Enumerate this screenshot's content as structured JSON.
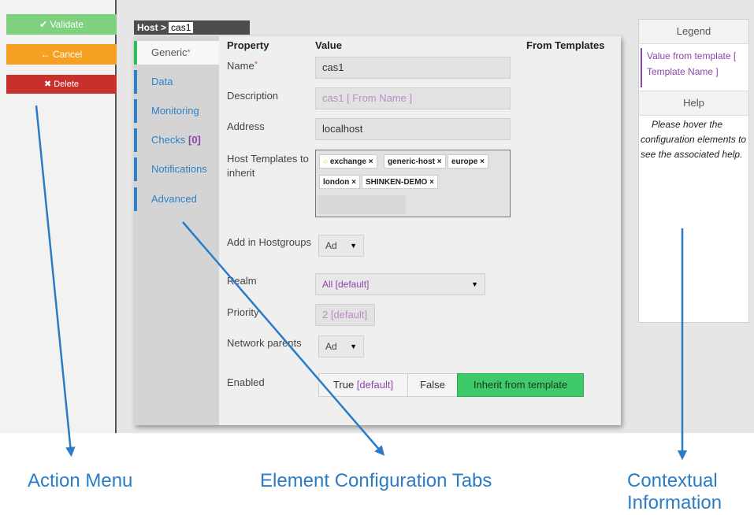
{
  "actions": {
    "validate": "✔ Validate",
    "cancel": "← Cancel",
    "delete": "✖ Delete"
  },
  "breadcrumb": {
    "prefix": "Host >",
    "host": "cas1"
  },
  "tabs": [
    {
      "label": "Generic",
      "required": "*"
    },
    {
      "label": "Data"
    },
    {
      "label": "Monitoring"
    },
    {
      "label": "Checks",
      "count": "[0]"
    },
    {
      "label": "Notifications"
    },
    {
      "label": "Advanced"
    }
  ],
  "table_headers": {
    "property": "Property",
    "value": "Value",
    "from_templates": "From Templates"
  },
  "fields": {
    "name": {
      "label": "Name",
      "required": "*",
      "value": "cas1"
    },
    "description": {
      "label": "Description",
      "value": "cas1 [ From Name ]"
    },
    "address": {
      "label": "Address",
      "value": "localhost"
    },
    "templates": {
      "label_line1": "Host Templates to",
      "label_line2": "inherit",
      "items": [
        "exchange ×",
        "generic-host ×",
        "europe ×",
        "london ×",
        "SHINKEN-DEMO ×"
      ]
    },
    "hostgroups": {
      "label": "Add in Hostgroups",
      "value": "Ad"
    },
    "realm": {
      "label": "Realm",
      "value": "All [default]"
    },
    "priority": {
      "label": "Priority",
      "value": "2 [default]"
    },
    "network_parents": {
      "label": "Network parents",
      "value": "Ad"
    },
    "enabled": {
      "label": "Enabled",
      "true_label": "True",
      "true_default": "[default]",
      "false_label": "False",
      "inherit_label": "Inherit from template"
    }
  },
  "context": {
    "legend_title": "Legend",
    "legend_text": "Value from template [ Template Name ]",
    "help_title": "Help",
    "help_text": "Please hover the configuration elements to see the associated help."
  },
  "captions": {
    "action_menu": "Action Menu",
    "tabs": "Element Configuration Tabs",
    "context_line1": "Contextual",
    "context_line2": "Information"
  },
  "colors": {
    "accent_blue": "#2a7cc7",
    "validate_green": "#7fd17f",
    "cancel_orange": "#f5a020",
    "delete_red": "#c9302c",
    "template_purple": "#8e44ad",
    "active_toggle": "#3ec96a"
  }
}
